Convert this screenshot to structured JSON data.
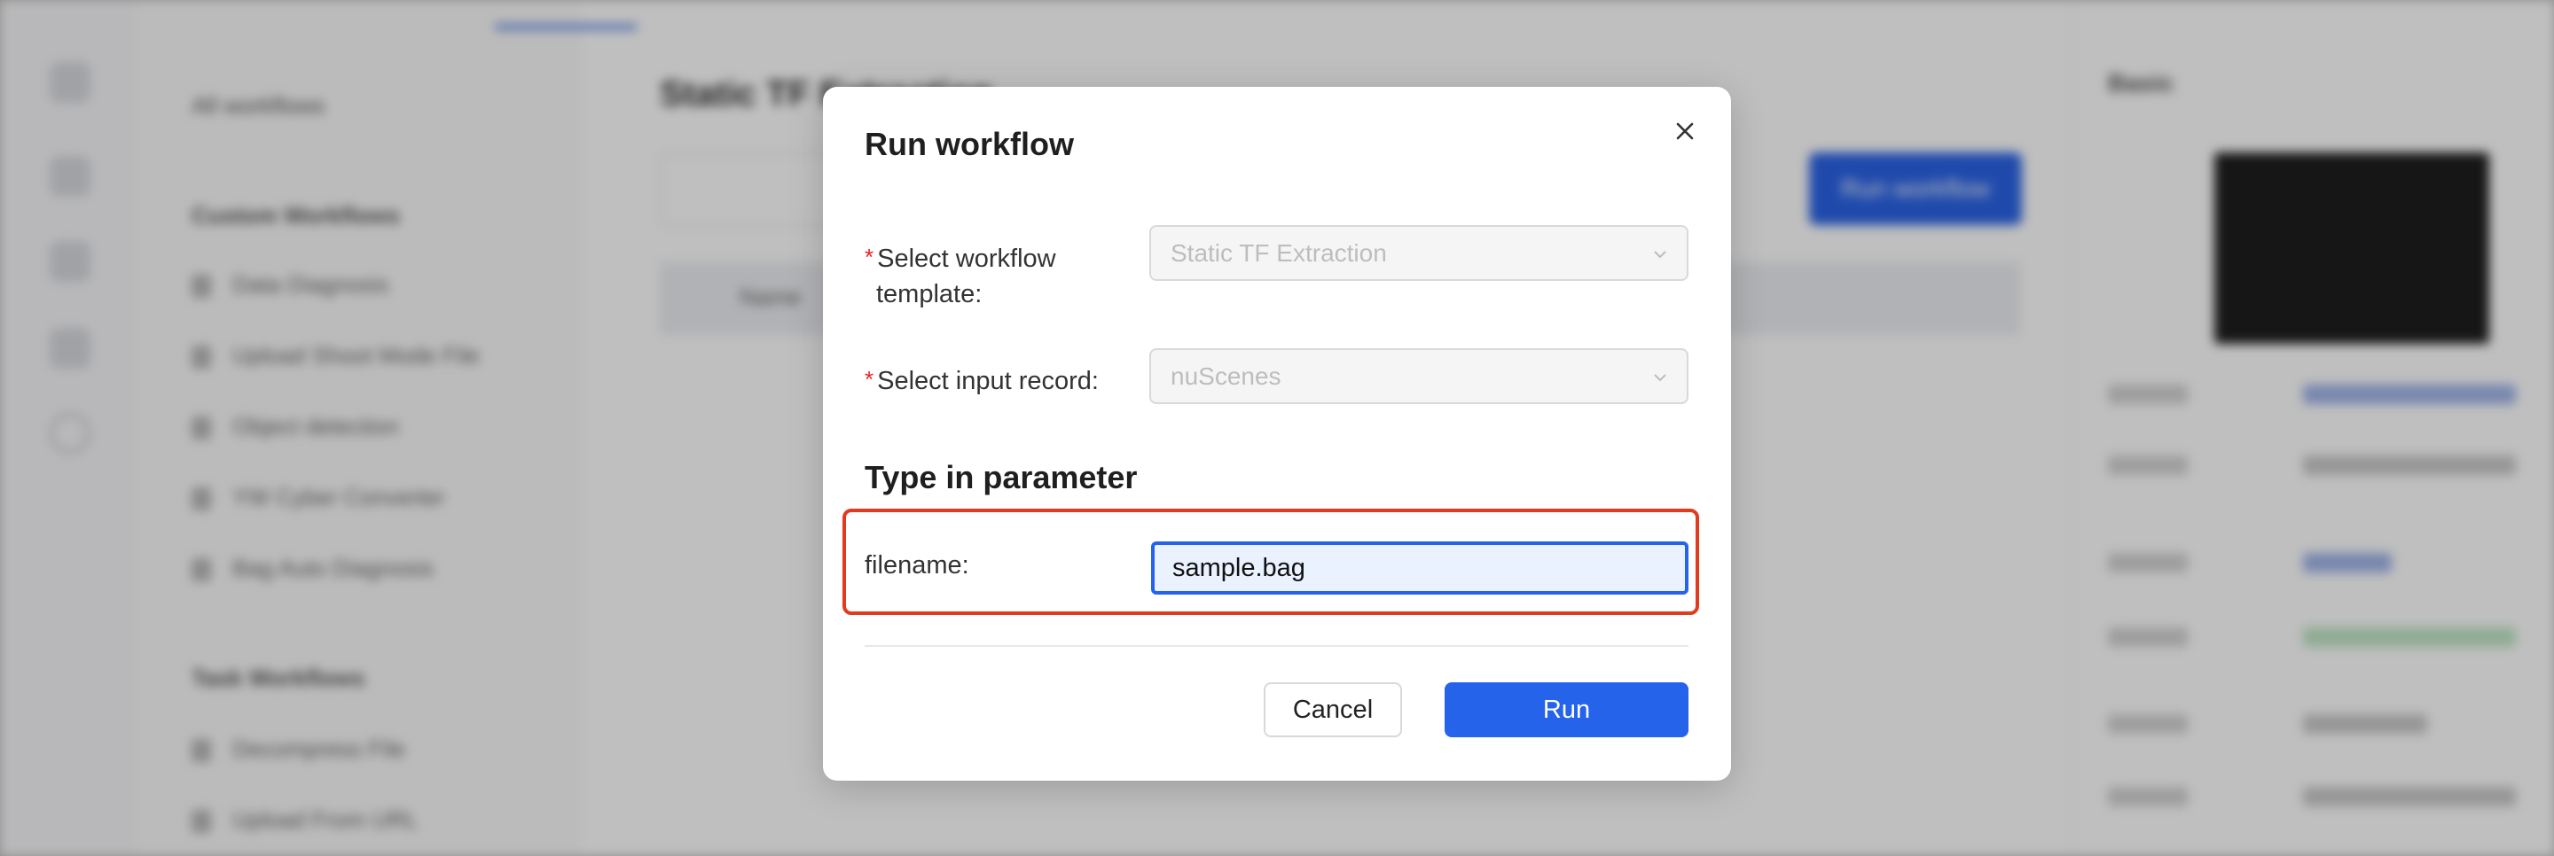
{
  "background": {
    "left_panel": {
      "all_label": "All workflows",
      "custom_heading": "Custom Workflows",
      "custom_items": [
        "Data Diagnosis",
        "Upload Shoot Mode File",
        "Object detection",
        "YW Cyber Converter",
        "Bag Auto Diagnosis"
      ],
      "task_heading": "Task Workflows",
      "task_items": [
        "Decompress File",
        "Upload From URL"
      ]
    },
    "main": {
      "title": "Static TF Extraction",
      "run_button": "Run workflow",
      "table_header": "Name"
    },
    "right_panel": {
      "heading": "Basic"
    }
  },
  "modal": {
    "title": "Run workflow",
    "close_icon": "close-icon",
    "template_label_line1": "Select workflow",
    "template_label_line2": "template:",
    "template_value": "Static TF Extraction",
    "record_label": "Select input record:",
    "record_value": "nuScenes",
    "required_mark": "*",
    "section_title": "Type in parameter",
    "param_label": "filename:",
    "param_value": "sample.bag",
    "cancel_label": "Cancel",
    "run_label": "Run"
  },
  "colors": {
    "primary": "#2563eb",
    "highlight_border": "#e23a1e",
    "required": "#e22222"
  }
}
